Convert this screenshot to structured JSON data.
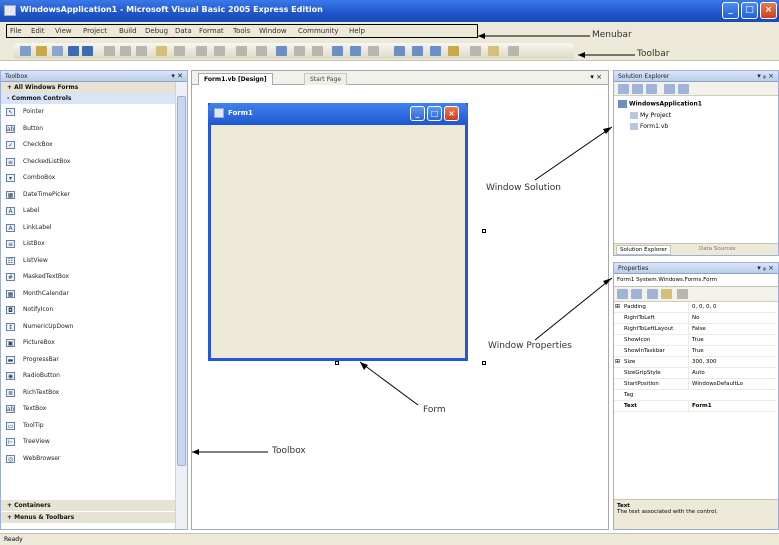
{
  "window": {
    "title": "WindowsApplication1 - Microsoft Visual Basic 2005 Express Edition",
    "minimize": "_",
    "maximize": "□",
    "close": "×"
  },
  "menubar": {
    "items": [
      "File",
      "Edit",
      "View",
      "Project",
      "Build",
      "Debug",
      "Data",
      "Format",
      "Tools",
      "Window",
      "Community",
      "Help"
    ]
  },
  "annotations": {
    "menubar": "Menubar",
    "toolbar": "Toolbar",
    "window_solution": "Window Solution",
    "window_properties": "Window Properties",
    "form": "Form",
    "toolbox": "Toolbox"
  },
  "toolbox": {
    "header": "Toolbox",
    "pin": "▾ ✕",
    "top_category": "+ All Windows Forms",
    "category": "- Common Controls",
    "items": [
      {
        "label": "Pointer",
        "icon": "pointer-icon",
        "glyph": "↖"
      },
      {
        "label": "Button",
        "icon": "button-icon",
        "glyph": "ab"
      },
      {
        "label": "CheckBox",
        "icon": "checkbox-icon",
        "glyph": "✓"
      },
      {
        "label": "CheckedListBox",
        "icon": "checkedlistbox-icon",
        "glyph": "≡"
      },
      {
        "label": "ComboBox",
        "icon": "combobox-icon",
        "glyph": "▾"
      },
      {
        "label": "DateTimePicker",
        "icon": "datetimepicker-icon",
        "glyph": "▦"
      },
      {
        "label": "Label",
        "icon": "label-icon",
        "glyph": "A"
      },
      {
        "label": "LinkLabel",
        "icon": "linklabel-icon",
        "glyph": "A"
      },
      {
        "label": "ListBox",
        "icon": "listbox-icon",
        "glyph": "≡"
      },
      {
        "label": "ListView",
        "icon": "listview-icon",
        "glyph": "☷"
      },
      {
        "label": "MaskedTextBox",
        "icon": "maskedtextbox-icon",
        "glyph": "#"
      },
      {
        "label": "MonthCalendar",
        "icon": "monthcalendar-icon",
        "glyph": "▦"
      },
      {
        "label": "NotifyIcon",
        "icon": "notifyicon-icon",
        "glyph": "◘"
      },
      {
        "label": "NumericUpDown",
        "icon": "numericupdown-icon",
        "glyph": "↕"
      },
      {
        "label": "PictureBox",
        "icon": "picturebox-icon",
        "glyph": "▣"
      },
      {
        "label": "ProgressBar",
        "icon": "progressbar-icon",
        "glyph": "▬"
      },
      {
        "label": "RadioButton",
        "icon": "radiobutton-icon",
        "glyph": "◉"
      },
      {
        "label": "RichTextBox",
        "icon": "richtextbox-icon",
        "glyph": "≣"
      },
      {
        "label": "TextBox",
        "icon": "textbox-icon",
        "glyph": "ab"
      },
      {
        "label": "ToolTip",
        "icon": "tooltip-icon",
        "glyph": "▭"
      },
      {
        "label": "TreeView",
        "icon": "treeview-icon",
        "glyph": "⊢"
      },
      {
        "label": "WebBrowser",
        "icon": "webbrowser-icon",
        "glyph": "◎"
      }
    ],
    "bottom_categories": [
      "+ Containers",
      "+ Menus & Toolbars"
    ]
  },
  "document": {
    "tabs": [
      "Form1.vb [Design]",
      "Start Page"
    ],
    "close": "▾ ×",
    "form_title": "Form1"
  },
  "solution_explorer": {
    "header": "Solution Explorer",
    "pin": "▾ ᵩ ×",
    "project": "WindowsApplication1",
    "children": [
      "My Project",
      "Form1.vb"
    ],
    "tabs": [
      "Solution Explorer",
      "Data Sources"
    ]
  },
  "properties": {
    "header": "Properties",
    "pin": "▾ ᵩ ×",
    "object": "Form1 System.Windows.Forms.Form",
    "rows": [
      {
        "name": "Padding",
        "value": "0, 0, 0, 0",
        "expand": "⊞"
      },
      {
        "name": "RightToLeft",
        "value": "No",
        "expand": ""
      },
      {
        "name": "RightToLeftLayout",
        "value": "False",
        "expand": ""
      },
      {
        "name": "ShowIcon",
        "value": "True",
        "expand": ""
      },
      {
        "name": "ShowInTaskbar",
        "value": "True",
        "expand": ""
      },
      {
        "name": "Size",
        "value": "300, 300",
        "expand": "⊞"
      },
      {
        "name": "SizeGripStyle",
        "value": "Auto",
        "expand": ""
      },
      {
        "name": "StartPosition",
        "value": "WindowsDefaultLo",
        "expand": ""
      },
      {
        "name": "Tag",
        "value": "",
        "expand": ""
      },
      {
        "name": "Text",
        "value": "Form1",
        "expand": ""
      }
    ],
    "description_title": "Text",
    "description_text": "The text associated with the control."
  },
  "status": {
    "text": "Ready"
  }
}
